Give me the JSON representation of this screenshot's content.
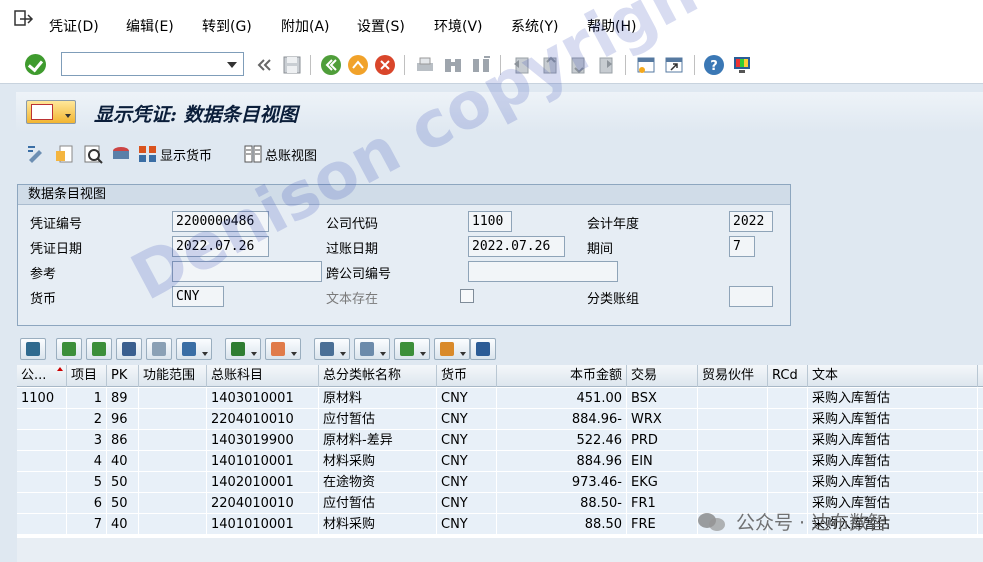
{
  "menu": {
    "items": [
      "凭证(D)",
      "编辑(E)",
      "转到(G)",
      "附加(A)",
      "设置(S)",
      "环境(V)",
      "系统(Y)",
      "帮助(H)"
    ]
  },
  "toolbar": {
    "command_value": ""
  },
  "title": {
    "text": "显示凭证: 数据条目视图"
  },
  "app_toolbar": {
    "show_currency": "显示货币",
    "gl_view": "总账视图"
  },
  "header": {
    "group_title": "数据条目视图",
    "doc_number_label": "凭证编号",
    "doc_number": "2200000486",
    "company_code_label": "公司代码",
    "company_code": "1100",
    "fiscal_year_label": "会计年度",
    "fiscal_year": "2022",
    "doc_date_label": "凭证日期",
    "doc_date": "2022.07.26",
    "posting_date_label": "过账日期",
    "posting_date": "2022.07.26",
    "period_label": "期间",
    "period": "7",
    "reference_label": "参考",
    "reference": "",
    "cross_company_label": "跨公司编号",
    "cross_company": "",
    "currency_label": "货币",
    "currency": "CNY",
    "text_exists_label": "文本存在",
    "ledger_group_label": "分类账组",
    "ledger_group": ""
  },
  "grid": {
    "columns": [
      "公...",
      "项目",
      "PK",
      "功能范围",
      "总账科目",
      "总分类帐名称",
      "货币",
      "本币金额",
      "交易",
      "贸易伙伴",
      "RCd",
      "文本"
    ],
    "rows": [
      {
        "cc": "1100",
        "item": "1",
        "pk": "89",
        "fa": "",
        "gl": "1403010001",
        "name": "原材料",
        "cur": "CNY",
        "amt": "451.00",
        "tt": "BSX",
        "tp": "",
        "rcd": "",
        "text": "采购入库暂估"
      },
      {
        "cc": "",
        "item": "2",
        "pk": "96",
        "fa": "",
        "gl": "2204010010",
        "name": "应付暂估",
        "cur": "CNY",
        "amt": "884.96-",
        "tt": "WRX",
        "tp": "",
        "rcd": "",
        "text": "采购入库暂估"
      },
      {
        "cc": "",
        "item": "3",
        "pk": "86",
        "fa": "",
        "gl": "1403019900",
        "name": "原材料-差异",
        "cur": "CNY",
        "amt": "522.46",
        "tt": "PRD",
        "tp": "",
        "rcd": "",
        "text": "采购入库暂估"
      },
      {
        "cc": "",
        "item": "4",
        "pk": "40",
        "fa": "",
        "gl": "1401010001",
        "name": "材料采购",
        "cur": "CNY",
        "amt": "884.96",
        "tt": "EIN",
        "tp": "",
        "rcd": "",
        "text": "采购入库暂估"
      },
      {
        "cc": "",
        "item": "5",
        "pk": "50",
        "fa": "",
        "gl": "1402010001",
        "name": "在途物资",
        "cur": "CNY",
        "amt": "973.46-",
        "tt": "EKG",
        "tp": "",
        "rcd": "",
        "text": "采购入库暂估"
      },
      {
        "cc": "",
        "item": "6",
        "pk": "50",
        "fa": "",
        "gl": "2204010010",
        "name": "应付暂估",
        "cur": "CNY",
        "amt": "88.50-",
        "tt": "FR1",
        "tp": "",
        "rcd": "",
        "text": "采购入库暂估"
      },
      {
        "cc": "",
        "item": "7",
        "pk": "40",
        "fa": "",
        "gl": "1401010001",
        "name": "材料采购",
        "cur": "CNY",
        "amt": "88.50",
        "tt": "FRE",
        "tp": "",
        "rcd": "",
        "text": "采购入库暂估"
      }
    ]
  },
  "watermark": {
    "text": "Denison copyright",
    "wechat": "公众号 · 达布数智"
  }
}
